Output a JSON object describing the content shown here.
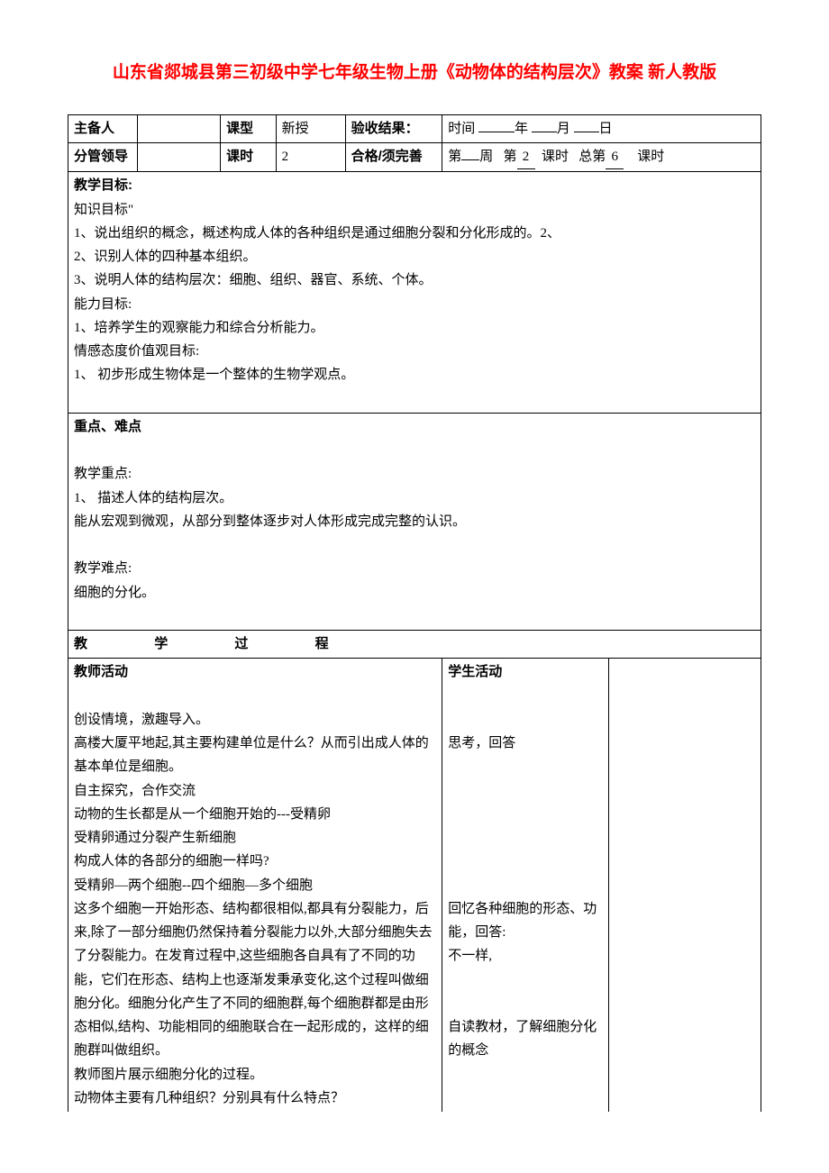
{
  "title": "山东省郯城县第三初级中学七年级生物上册《动物体的结构层次》教案 新人教版",
  "header": {
    "row1": {
      "c1": "主备人",
      "c3": "课型",
      "c4": "新授",
      "c5": "验收结果：",
      "time_label": "时间",
      "year_suffix": "年",
      "month_suffix": "月",
      "day_suffix": "日"
    },
    "row2": {
      "c1": "分管领导",
      "c3": "课时",
      "c4": "2",
      "c5": "合格/须完善",
      "week_prefix": "第",
      "week_suffix": "周",
      "period_prefix": "第",
      "period_value": "2",
      "period_suffix": "课时",
      "total_prefix": "总第",
      "total_value": "6",
      "total_suffix": "课时"
    }
  },
  "objectives": {
    "heading": "教学目标:",
    "sub1": "知识目标\"",
    "l1": "1、说出组织的概念，概述构成人体的各种组织是通过细胞分裂和分化形成的。2、",
    "l2": "2、识别人体的四种基本组织。",
    "l3": "3、说明人体的结构层次：细胞、组织、器官、系统、个体。",
    "sub2": "能力目标:",
    "l4": "1、培养学生的观察能力和综合分析能力。",
    "sub3": "情感态度价值观目标:",
    "l5": "1、 初步形成生物体是一个整体的生物学观点。"
  },
  "keypoints": {
    "heading": "重点、难点",
    "sub1": "教学重点:",
    "l1": "1、 描述人体的结构层次。",
    "l2": "能从宏观到微观，从部分到整体逐步对人体形成完成完整的认识。",
    "sub2": "教学难点:",
    "l3": "细胞的分化。"
  },
  "process": {
    "heading_a": "教",
    "heading_b": "学",
    "heading_c": "过",
    "heading_d": "程",
    "teacher_heading": "教师活动",
    "student_heading": "学生活动",
    "teacher": {
      "p1": "创设情境，激趣导入。",
      "p2": "高楼大厦平地起,其主要构建单位是什么？从而引出成人体的基本单位是细胞。",
      "p3": "自主探究，合作交流",
      "p4": "动物的生长都是从一个细胞开始的---受精卵",
      "p5": "受精卵通过分裂产生新细胞",
      "p6": "构成人体的各部分的细胞一样吗?",
      "p7": "受精卵—两个细胞--四个细胞—多个细胞",
      "p8": "这多个细胞一开始形态、结构都很相似,都具有分裂能力，后来,除了一部分细胞仍然保持着分裂能力以外,大部分细胞失去了分裂能力。在发育过程中,这些细胞各自具有了不同的功能，它们在形态、结构上也逐渐发秉承变化,这个过程叫做细胞分化。细胞分化产生了不同的细胞群,每个细胞群都是由形态相似,结构、功能相同的细胞联合在一起形成的，这样的细胞群叫做组织。",
      "p9": "教师图片展示细胞分化的过程。",
      "p10": "动物体主要有几种组织？分别具有什么特点？"
    },
    "student": {
      "s1": "思考，回答",
      "s2": "回忆各种细胞的形态、功能，回答:",
      "s3": "不一样,",
      "s4": "自读教材，了解细胞分化的概念"
    }
  }
}
